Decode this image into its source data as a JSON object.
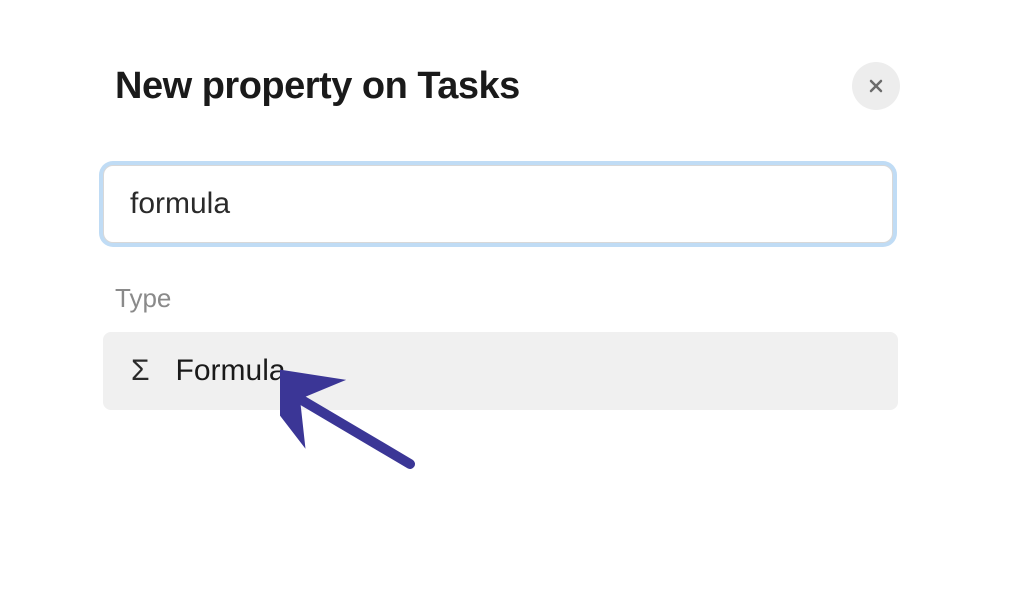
{
  "modal": {
    "title": "New property on Tasks",
    "input_value": "formula",
    "section_label": "Type",
    "option": {
      "icon": "Σ",
      "label": "Formula"
    }
  }
}
